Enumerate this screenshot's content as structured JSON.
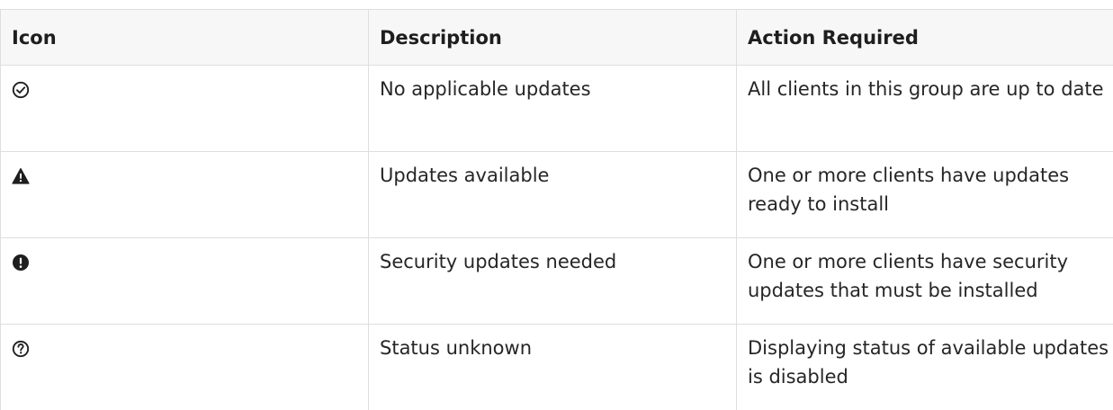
{
  "table": {
    "headers": {
      "icon": "Icon",
      "description": "Description",
      "action": "Action Required"
    },
    "rows": [
      {
        "icon": "check-circle-icon",
        "description": "No applicable updates",
        "action": "All clients in this group are up to date"
      },
      {
        "icon": "warning-triangle-icon",
        "description": "Updates available",
        "action": "One or more clients have updates ready to install"
      },
      {
        "icon": "exclamation-circle-icon",
        "description": "Security updates needed",
        "action": "One or more clients have security updates that must be installed"
      },
      {
        "icon": "question-circle-icon",
        "description": "Status unknown",
        "action": "Displaying status of available updates is disabled"
      }
    ]
  }
}
